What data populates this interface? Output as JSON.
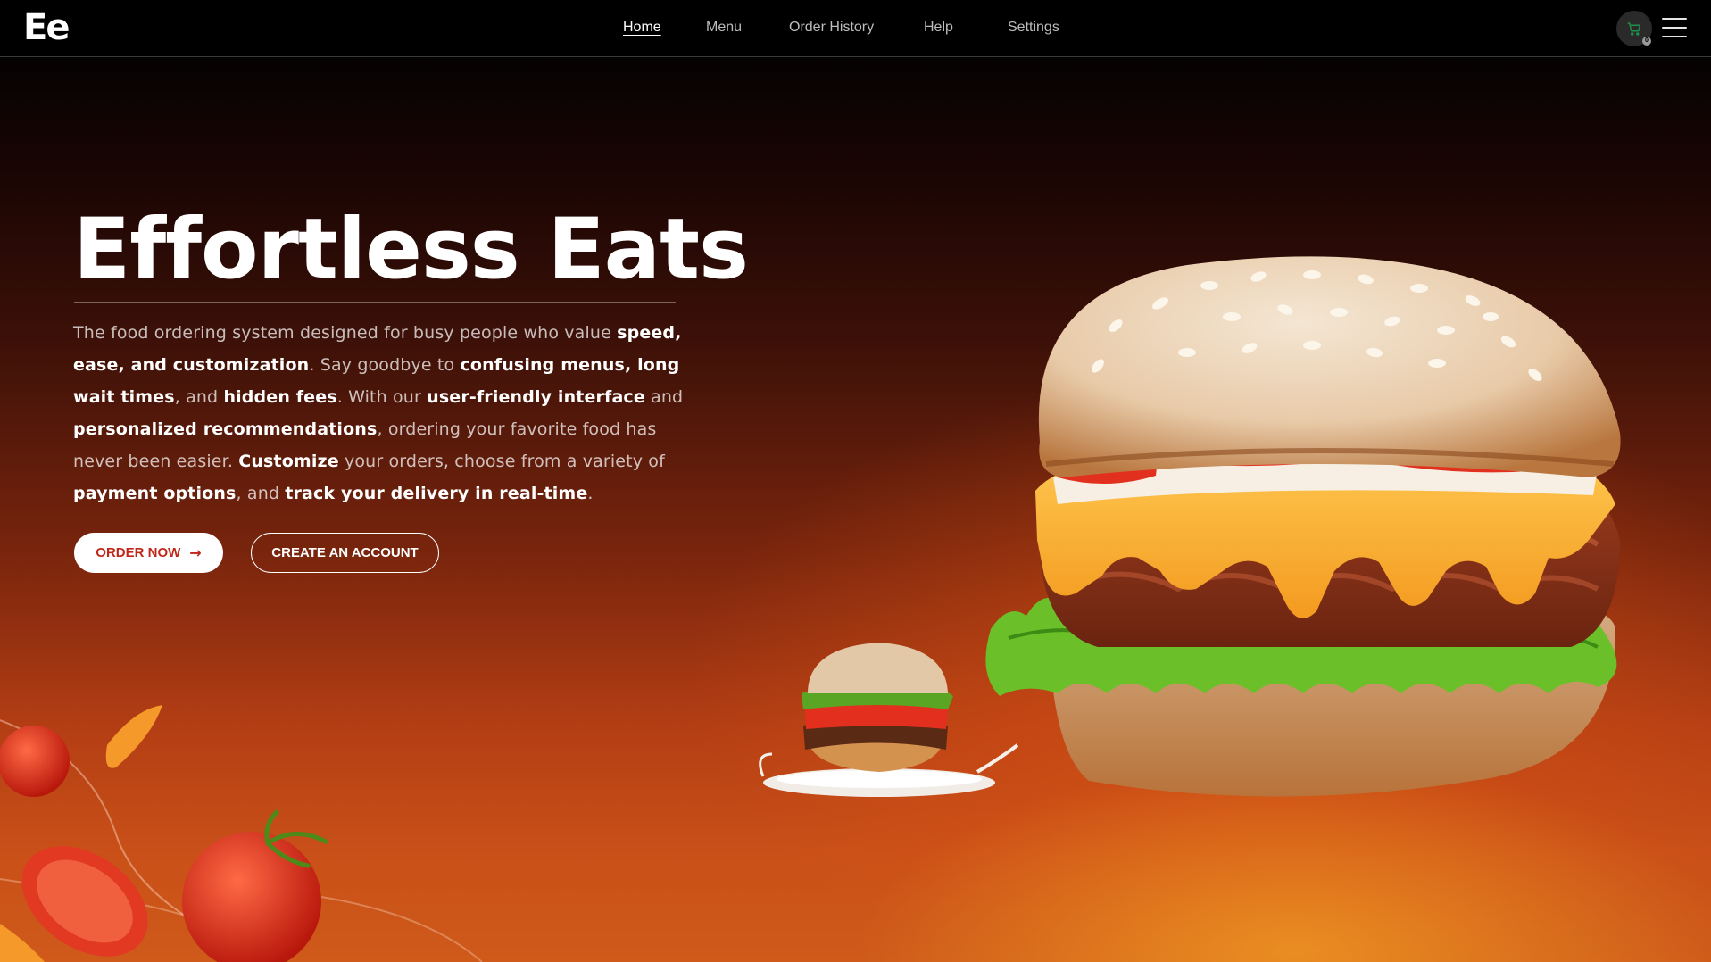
{
  "brand": {
    "logo": "Ee"
  },
  "nav": {
    "links": [
      {
        "label": "Home",
        "active": true
      },
      {
        "label": "Menu",
        "active": false
      },
      {
        "label": "Order History",
        "active": false
      },
      {
        "label": "Help",
        "active": false
      },
      {
        "label": "Settings",
        "active": false
      }
    ],
    "cart_count": "0",
    "cart_icon": "cart-icon",
    "menu_icon": "hamburger-menu-icon"
  },
  "hero": {
    "title": "Effortless Eats",
    "description": [
      {
        "text": "The food ordering system designed for busy people who value ",
        "bold": false
      },
      {
        "text": "speed, ease, and customization",
        "bold": true
      },
      {
        "text": ". Say goodbye to ",
        "bold": false
      },
      {
        "text": "confusing menus, long wait times",
        "bold": true
      },
      {
        "text": ", and ",
        "bold": false
      },
      {
        "text": "hidden fees",
        "bold": true
      },
      {
        "text": ". With our ",
        "bold": false
      },
      {
        "text": "user-friendly interface",
        "bold": true
      },
      {
        "text": " and ",
        "bold": false
      },
      {
        "text": "personalized recommendations",
        "bold": true
      },
      {
        "text": ", ordering your favorite food has never been easier. ",
        "bold": false
      },
      {
        "text": "Customize",
        "bold": true
      },
      {
        "text": " your orders, choose from a variety of ",
        "bold": false
      },
      {
        "text": "payment options",
        "bold": true
      },
      {
        "text": ", and ",
        "bold": false
      },
      {
        "text": "track your delivery in real-time",
        "bold": true
      },
      {
        "text": ".",
        "bold": false
      }
    ],
    "order_button": "ORDER NOW",
    "order_arrow": "→",
    "create_button": "CREATE AN ACCOUNT"
  },
  "colors": {
    "accent_red": "#c0271a",
    "background_dark": "#000000",
    "hero_orange": "#cf5a1a"
  }
}
